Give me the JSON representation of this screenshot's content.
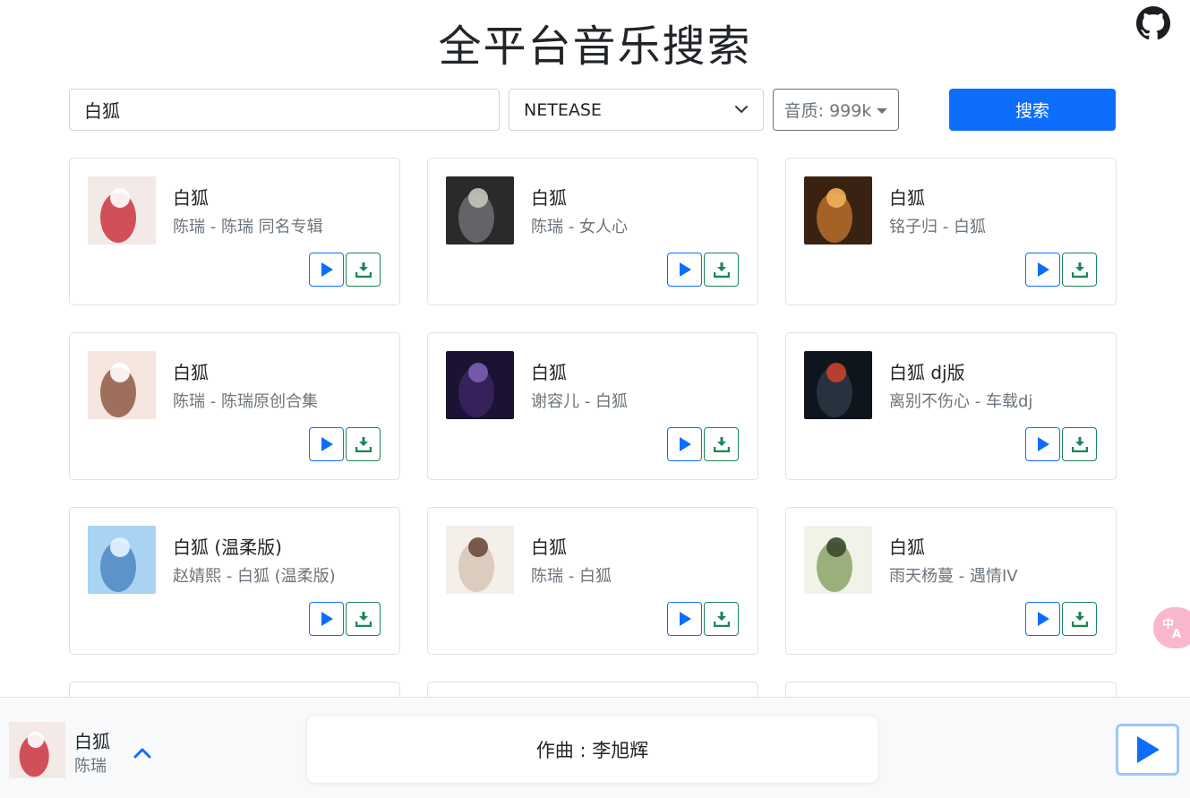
{
  "header": {
    "title": "全平台音乐搜索",
    "github_icon": "github-icon"
  },
  "search": {
    "query": "白狐",
    "platform": "NETEASE",
    "quality_label": "音质: 999k",
    "search_button": "搜索"
  },
  "results": [
    {
      "title": "白狐",
      "subtitle": "陈瑞 - 陈瑞 同名专辑",
      "cover_colors": [
        "#f3e9e6",
        "#c9343f",
        "#ffffff"
      ]
    },
    {
      "title": "白狐",
      "subtitle": "陈瑞 - 女人心",
      "cover_colors": [
        "#2a2a2a",
        "#6d6f73",
        "#c7c2bb"
      ]
    },
    {
      "title": "白狐",
      "subtitle": "铭子归 - 白狐",
      "cover_colors": [
        "#3a2212",
        "#b86d2c",
        "#f0b05a"
      ]
    },
    {
      "title": "白狐",
      "subtitle": "陈瑞 - 陈瑞原创合集",
      "cover_colors": [
        "#f7e6df",
        "#8e5a45",
        "#ffffff"
      ]
    },
    {
      "title": "白狐",
      "subtitle": "谢容儿 - 白狐",
      "cover_colors": [
        "#1b1234",
        "#3b2463",
        "#7c5fb0"
      ]
    },
    {
      "title": "白狐 dj版",
      "subtitle": "离别不伤心 - 车载dj",
      "cover_colors": [
        "#0f151c",
        "#2c3744",
        "#c9402f"
      ]
    },
    {
      "title": "白狐 (温柔版)",
      "subtitle": "赵婧熙 - 白狐 (温柔版)",
      "cover_colors": [
        "#a9d3f2",
        "#4f87c4",
        "#e8f4ff"
      ]
    },
    {
      "title": "白狐",
      "subtitle": "陈瑞 - 白狐",
      "cover_colors": [
        "#f4efe9",
        "#d7c5b6",
        "#6b4b3c"
      ]
    },
    {
      "title": "白狐",
      "subtitle": "雨天杨蔓 - 遇情IV",
      "cover_colors": [
        "#f1f2e8",
        "#8ca36a",
        "#3b4a2a"
      ]
    }
  ],
  "player": {
    "title": "白狐",
    "artist": "陈瑞",
    "lyric": "作曲 : 李旭辉",
    "cover_colors": [
      "#f3e9e6",
      "#c9343f",
      "#ffffff"
    ]
  },
  "translate_badge": "中A"
}
